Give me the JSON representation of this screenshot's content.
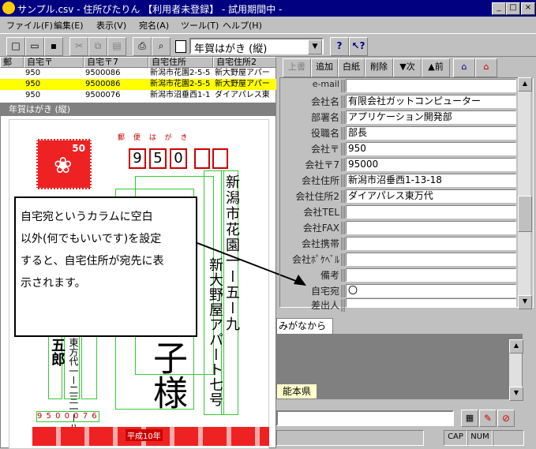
{
  "window": {
    "title": "サンプル.csv - 住所ぴたりん 【利用者未登録】 - 試用期間中 -"
  },
  "menu": [
    "ファイル(F)",
    "編集(E)",
    "表示(V)",
    "宛名(A)",
    "ツール(T)",
    "ヘルプ(H)"
  ],
  "toolbar": {
    "template_select": "年賀はがき (縦)"
  },
  "grid": {
    "headers": [
      "郵",
      "自宅〒",
      "自宅〒7",
      "自宅住所",
      "自宅住所2"
    ],
    "rows": [
      [
        "",
        "950",
        "9500086",
        "新潟市花園2-5-5",
        "新大野屋アパー"
      ],
      [
        "",
        "950",
        "9500086",
        "新潟市花園2-5-5",
        "新大野屋アパー"
      ],
      [
        "",
        "950",
        "9500076",
        "新潟市沼垂西1-1",
        "ダイアパレス東"
      ]
    ]
  },
  "preview": {
    "title": "年賀はがき (縦)",
    "postcard_header": "郵 便 は が き",
    "stamp_value": "50",
    "postal_boxes": [
      "9",
      "5",
      "0",
      "",
      ""
    ],
    "recipient_address1": "新潟市花園一ー五ー九",
    "recipient_address2": "新大野屋アパート七号",
    "recipient_name": "子様",
    "sender_address": "東方代一ー二三一ー八",
    "sender_name": "五郎",
    "sender_zip": "9 5 0 0 0 7 6",
    "lottery_label": "平成10年"
  },
  "callout": {
    "lines": [
      "自宅宛というカラムに空白",
      "以外(何でもいいです)を設定",
      "すると、自宅住所が宛先に表",
      "示されます。"
    ]
  },
  "form": {
    "buttons": [
      "上書",
      "追加",
      "白紙",
      "削除",
      "▼次",
      "▲前"
    ],
    "fields": [
      {
        "label": "e-mail",
        "value": ""
      },
      {
        "label": "会社名",
        "value": "有限会社ガットコンピューター"
      },
      {
        "label": "部署名",
        "value": "アプリケーション開発部"
      },
      {
        "label": "役職名",
        "value": "部長"
      },
      {
        "label": "会社〒",
        "value": "950"
      },
      {
        "label": "会社〒7",
        "value": "95000"
      },
      {
        "label": "会社住所",
        "value": "新潟市沼垂西1-13-18"
      },
      {
        "label": "会社住所2",
        "value": "ダイアパレス東万代"
      },
      {
        "label": "会社TEL",
        "value": ""
      },
      {
        "label": "会社FAX",
        "value": ""
      },
      {
        "label": "会社携帯",
        "value": ""
      },
      {
        "label": "会社ﾎﾟｹﾍﾞﾙ",
        "value": ""
      },
      {
        "label": "備考",
        "value": ""
      },
      {
        "label": "自宅宛",
        "value": "〇"
      },
      {
        "label": "差出人",
        "value": ""
      }
    ]
  },
  "lower_panel": {
    "tab_label": "みがなから",
    "item": "能本県"
  },
  "status": {
    "caps": "CAP",
    "num": "NUM"
  }
}
